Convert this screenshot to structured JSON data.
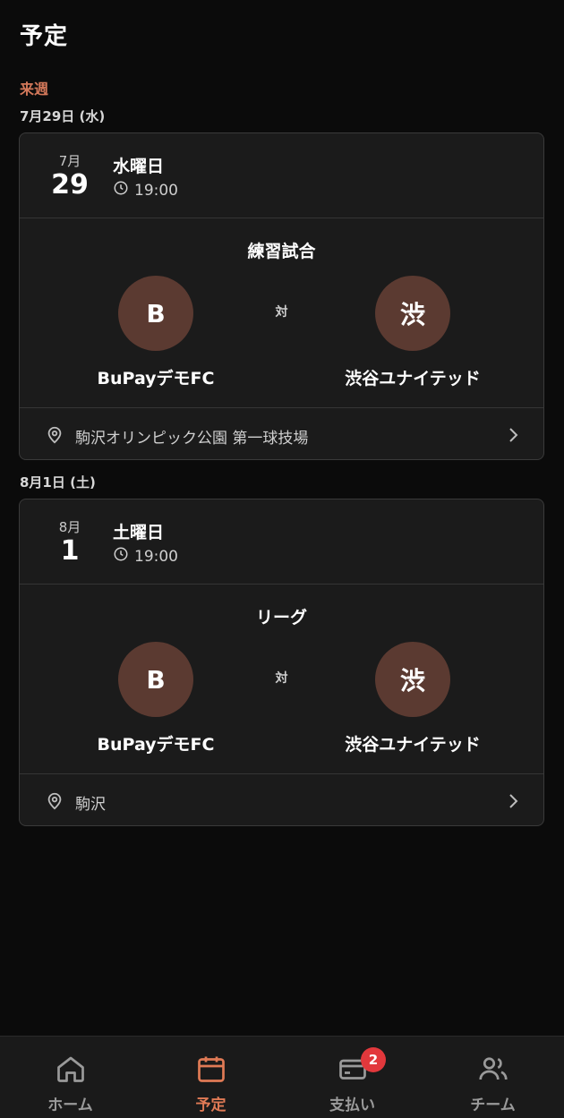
{
  "header": {
    "title": "予定"
  },
  "section": {
    "label": "来週"
  },
  "events": [
    {
      "date_heading": "7月29日 (水)",
      "month": "7月",
      "day": "29",
      "weekday": "水曜日",
      "time": "19:00",
      "match_type": "練習試合",
      "vs": "対",
      "home": {
        "initial": "B",
        "name": "BuPayデモFC"
      },
      "away": {
        "initial": "渋",
        "name": "渋谷ユナイテッド"
      },
      "location": "駒沢オリンピック公園 第一球技場"
    },
    {
      "date_heading": "8月1日 (土)",
      "month": "8月",
      "day": "1",
      "weekday": "土曜日",
      "time": "19:00",
      "match_type": "リーグ",
      "vs": "対",
      "home": {
        "initial": "B",
        "name": "BuPayデモFC"
      },
      "away": {
        "initial": "渋",
        "name": "渋谷ユナイテッド"
      },
      "location": "駒沢"
    }
  ],
  "nav": {
    "items": [
      {
        "label": "ホーム",
        "icon": "home-icon"
      },
      {
        "label": "予定",
        "icon": "calendar-icon",
        "active": true
      },
      {
        "label": "支払い",
        "icon": "card-icon",
        "badge": "2"
      },
      {
        "label": "チーム",
        "icon": "users-icon"
      }
    ]
  },
  "colors": {
    "accent": "#e07a55",
    "badge": "#e2383c",
    "avatar": "#5b3a31",
    "card": "#1b1b1b"
  }
}
